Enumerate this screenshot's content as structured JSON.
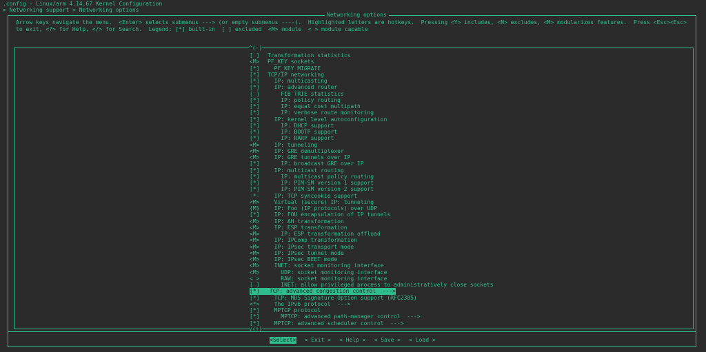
{
  "window": {
    "title": ".config - Linux/arm 4.14.67 Kernel Configuration",
    "breadcrumb": "> Networking support > Networking options"
  },
  "dialog": {
    "title": "Networking options",
    "help_text": "Arrow keys navigate the menu.  <Enter> selects submenus ---> (or empty submenus ----).  Highlighted letters are hotkeys.  Pressing <Y> includes, <N> excludes, <M> modularizes features.  Press <Esc><Esc> to exit, <?> for Help, </> for Search.  Legend: [*] built-in  [ ] excluded  <M> module  < > module capable",
    "scroll_up": "^(-)",
    "scroll_down": "v(+)"
  },
  "menu": [
    {
      "state": "[ ]",
      "label": "Transformation statistics",
      "indent": 0
    },
    {
      "state": "<M>",
      "label": "PF_KEY sockets",
      "indent": 0
    },
    {
      "state": "[*]",
      "label": "  PF_KEY MIGRATE",
      "indent": 1
    },
    {
      "state": "[*]",
      "label": "TCP/IP networking",
      "indent": 0
    },
    {
      "state": "[*]",
      "label": "  IP: multicasting",
      "indent": 1
    },
    {
      "state": "[*]",
      "label": "  IP: advanced router",
      "indent": 1
    },
    {
      "state": "[ ]",
      "label": "    FIB TRIE statistics",
      "indent": 2
    },
    {
      "state": "[*]",
      "label": "    IP: policy routing",
      "indent": 2
    },
    {
      "state": "[*]",
      "label": "    IP: equal cost multipath",
      "indent": 2
    },
    {
      "state": "[*]",
      "label": "    IP: verbose route monitoring",
      "indent": 2
    },
    {
      "state": "[*]",
      "label": "  IP: kernel level autoconfiguration",
      "indent": 1
    },
    {
      "state": "[*]",
      "label": "    IP: DHCP support",
      "indent": 2
    },
    {
      "state": "[*]",
      "label": "    IP: BOOTP support",
      "indent": 2
    },
    {
      "state": "[*]",
      "label": "    IP: RARP support",
      "indent": 2
    },
    {
      "state": "<M>",
      "label": "  IP: tunneling",
      "indent": 1
    },
    {
      "state": "<M>",
      "label": "  IP: GRE demultiplexer",
      "indent": 1
    },
    {
      "state": "<M>",
      "label": "  IP: GRE tunnels over IP",
      "indent": 1
    },
    {
      "state": "[*]",
      "label": "    IP: broadcast GRE over IP",
      "indent": 2
    },
    {
      "state": "[*]",
      "label": "  IP: multicast routing",
      "indent": 1
    },
    {
      "state": "[*]",
      "label": "    IP: multicast policy routing",
      "indent": 2
    },
    {
      "state": "[*]",
      "label": "    IP: PIM-SM version 1 support",
      "indent": 2
    },
    {
      "state": "[*]",
      "label": "    IP: PIM-SM version 2 support",
      "indent": 2
    },
    {
      "state": "-*-",
      "label": "  IP: TCP syncookie support",
      "indent": 1
    },
    {
      "state": "<M>",
      "label": "  Virtual (secure) IP: tunneling",
      "indent": 1
    },
    {
      "state": "{M}",
      "label": "  IP: Foo (IP protocols) over UDP",
      "indent": 1
    },
    {
      "state": "[*]",
      "label": "  IP: FOU encapsulation of IP tunnels",
      "indent": 1
    },
    {
      "state": "<M>",
      "label": "  IP: AH transformation",
      "indent": 1
    },
    {
      "state": "<M>",
      "label": "  IP: ESP transformation",
      "indent": 1
    },
    {
      "state": "<M>",
      "label": "    IP: ESP transformation offload",
      "indent": 2
    },
    {
      "state": "<M>",
      "label": "  IP: IPComp transformation",
      "indent": 1
    },
    {
      "state": "<M>",
      "label": "  IP: IPsec transport mode",
      "indent": 1
    },
    {
      "state": "<M>",
      "label": "  IP: IPsec tunnel mode",
      "indent": 1
    },
    {
      "state": "<M>",
      "label": "  IP: IPsec BEET mode",
      "indent": 1
    },
    {
      "state": "<M>",
      "label": "  INET: socket monitoring interface",
      "indent": 1
    },
    {
      "state": "<M>",
      "label": "    UDP: socket monitoring interface",
      "indent": 2
    },
    {
      "state": "< >",
      "label": "    RAW: socket monitoring interface",
      "indent": 2
    },
    {
      "state": "[ ]",
      "label": "    INET: allow privileged process to administratively close sockets",
      "indent": 2
    },
    {
      "state": "[*]",
      "label": "  TCP: advanced congestion control  --->",
      "indent": 1,
      "selected": true
    },
    {
      "state": "[*]",
      "label": "  TCP: MD5 Signature Option support (RFC2385)",
      "indent": 1
    },
    {
      "state": "<*>",
      "label": "  The IPv6 protocol  --->",
      "indent": 1
    },
    {
      "state": "[*]",
      "label": "  MPTCP protocol",
      "indent": 1
    },
    {
      "state": "[*]",
      "label": "    MPTCP: advanced path-manager control  --->",
      "indent": 2
    },
    {
      "state": "[*]",
      "label": "  MPTCP: advanced scheduler control  --->",
      "indent": 1
    }
  ],
  "buttons": [
    {
      "label": "<Select>",
      "active": true
    },
    {
      "label": "< Exit >",
      "active": false
    },
    {
      "label": "< Help >",
      "active": false
    },
    {
      "label": "< Save >",
      "active": false
    },
    {
      "label": "< Load >",
      "active": false
    }
  ],
  "colors": {
    "background": "#2b2b2b",
    "foreground": "#2fbf8f",
    "highlight_text": "#1d1d1d"
  }
}
